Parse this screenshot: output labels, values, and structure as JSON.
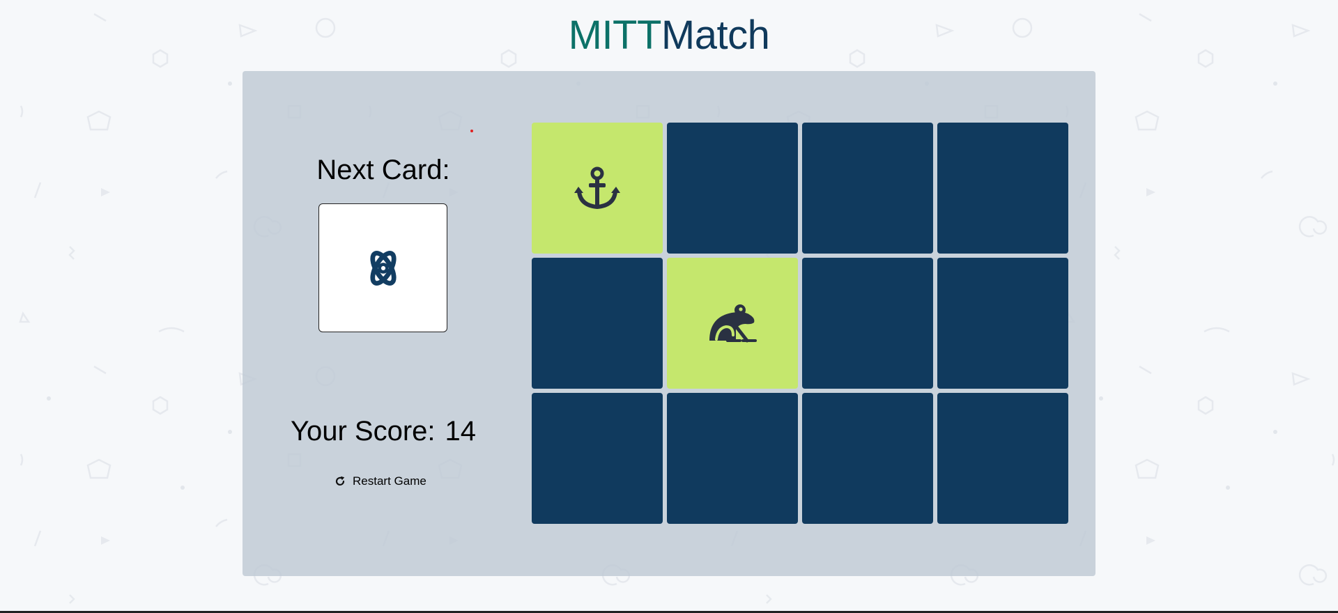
{
  "app": {
    "title_part1": "MITT",
    "title_part2": "Match"
  },
  "colors": {
    "title_teal": "#0c7168",
    "title_navy": "#103a5c",
    "card_back": "#103a5e",
    "card_revealed": "#c5e76d",
    "icon_dark": "#2a3142"
  },
  "next_card": {
    "label": "Next Card:",
    "icon": "atom-icon"
  },
  "score": {
    "label": "Your Score:",
    "value": "14"
  },
  "restart": {
    "label": "Restart Game",
    "icon": "refresh-icon"
  },
  "grid": {
    "rows": 3,
    "cols": 4,
    "cards": [
      {
        "state": "revealed",
        "icon": "anchor-icon"
      },
      {
        "state": "hidden"
      },
      {
        "state": "hidden"
      },
      {
        "state": "hidden"
      },
      {
        "state": "hidden"
      },
      {
        "state": "revealed",
        "icon": "frog-icon"
      },
      {
        "state": "hidden"
      },
      {
        "state": "hidden"
      },
      {
        "state": "hidden"
      },
      {
        "state": "hidden"
      },
      {
        "state": "hidden"
      },
      {
        "state": "hidden"
      }
    ]
  }
}
